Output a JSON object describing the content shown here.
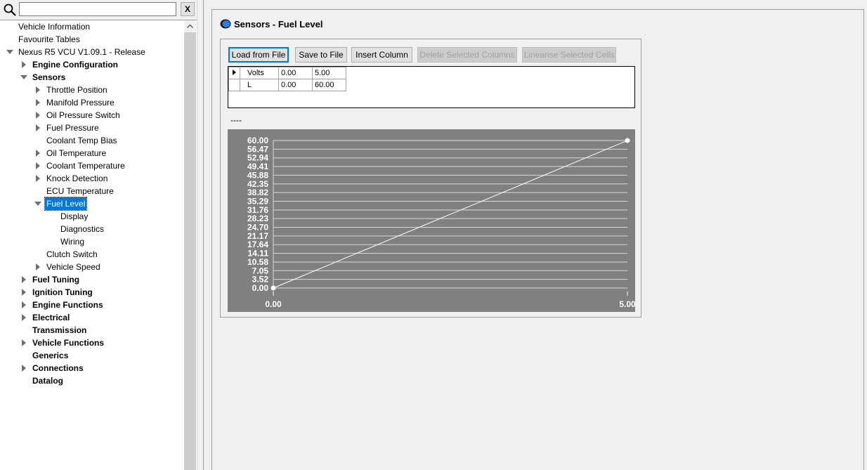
{
  "search": {
    "value": "",
    "clear_label": "X"
  },
  "tree": [
    {
      "id": "vehicle-information",
      "label": "Vehicle Information",
      "depth": 0,
      "arrow": "none",
      "bold": false
    },
    {
      "id": "favourite-tables",
      "label": "Favourite Tables",
      "depth": 0,
      "arrow": "none",
      "bold": false
    },
    {
      "id": "nexus-r5-vcu",
      "label": "Nexus R5 VCU V1.09.1 - Release",
      "depth": 0,
      "arrow": "expanded",
      "bold": false
    },
    {
      "id": "engine-configuration",
      "label": "Engine Configuration",
      "depth": 1,
      "arrow": "collapsed",
      "bold": true
    },
    {
      "id": "sensors",
      "label": "Sensors",
      "depth": 1,
      "arrow": "expanded",
      "bold": true
    },
    {
      "id": "throttle-position",
      "label": "Throttle Position",
      "depth": 2,
      "arrow": "collapsed",
      "bold": false
    },
    {
      "id": "manifold-pressure",
      "label": "Manifold Pressure",
      "depth": 2,
      "arrow": "collapsed",
      "bold": false
    },
    {
      "id": "oil-pressure-switch",
      "label": "Oil Pressure Switch",
      "depth": 2,
      "arrow": "collapsed",
      "bold": false
    },
    {
      "id": "fuel-pressure",
      "label": "Fuel Pressure",
      "depth": 2,
      "arrow": "collapsed",
      "bold": false
    },
    {
      "id": "coolant-temp-bias",
      "label": "Coolant Temp Bias",
      "depth": 2,
      "arrow": "none",
      "bold": false
    },
    {
      "id": "oil-temperature",
      "label": "Oil Temperature",
      "depth": 2,
      "arrow": "collapsed",
      "bold": false
    },
    {
      "id": "coolant-temperature",
      "label": "Coolant Temperature",
      "depth": 2,
      "arrow": "collapsed",
      "bold": false
    },
    {
      "id": "knock-detection",
      "label": "Knock Detection",
      "depth": 2,
      "arrow": "collapsed",
      "bold": false
    },
    {
      "id": "ecu-temperature",
      "label": "ECU Temperature",
      "depth": 2,
      "arrow": "none",
      "bold": false
    },
    {
      "id": "fuel-level",
      "label": "Fuel Level",
      "depth": 2,
      "arrow": "expanded",
      "bold": false,
      "selected": true
    },
    {
      "id": "display",
      "label": "Display",
      "depth": 3,
      "arrow": "none",
      "bold": false
    },
    {
      "id": "diagnostics",
      "label": "Diagnostics",
      "depth": 3,
      "arrow": "none",
      "bold": false
    },
    {
      "id": "wiring",
      "label": "Wiring",
      "depth": 3,
      "arrow": "none",
      "bold": false
    },
    {
      "id": "clutch-switch",
      "label": "Clutch Switch",
      "depth": 2,
      "arrow": "none",
      "bold": false
    },
    {
      "id": "vehicle-speed",
      "label": "Vehicle Speed",
      "depth": 2,
      "arrow": "collapsed",
      "bold": false
    },
    {
      "id": "fuel-tuning",
      "label": "Fuel Tuning",
      "depth": 1,
      "arrow": "collapsed",
      "bold": true
    },
    {
      "id": "ignition-tuning",
      "label": "Ignition Tuning",
      "depth": 1,
      "arrow": "collapsed",
      "bold": true
    },
    {
      "id": "engine-functions",
      "label": "Engine Functions",
      "depth": 1,
      "arrow": "collapsed",
      "bold": true
    },
    {
      "id": "electrical",
      "label": "Electrical",
      "depth": 1,
      "arrow": "collapsed",
      "bold": true
    },
    {
      "id": "transmission",
      "label": "Transmission",
      "depth": 1,
      "arrow": "none",
      "bold": true
    },
    {
      "id": "vehicle-functions",
      "label": "Vehicle Functions",
      "depth": 1,
      "arrow": "collapsed",
      "bold": true
    },
    {
      "id": "generics",
      "label": "Generics",
      "depth": 1,
      "arrow": "none",
      "bold": true
    },
    {
      "id": "connections",
      "label": "Connections",
      "depth": 1,
      "arrow": "collapsed",
      "bold": true
    },
    {
      "id": "datalog",
      "label": "Datalog",
      "depth": 1,
      "arrow": "none",
      "bold": true
    }
  ],
  "main": {
    "title": "Sensors - Fuel Level",
    "toolbar": {
      "load": "Load from File",
      "save": "Save to File",
      "insert": "Insert Column",
      "delete": "Delete Selected Columns",
      "linearise": "Linearise Selected Cells"
    },
    "table": [
      {
        "name": "Volts",
        "values": [
          "0.00",
          "5.00"
        ]
      },
      {
        "name": "L",
        "values": [
          "0.00",
          "60.00"
        ]
      }
    ],
    "caption": "----"
  },
  "colors": {
    "chart_bg": "#808080",
    "chart_line": "#ffffff",
    "selection": "#0078d7",
    "primary_border": "#0078d7"
  },
  "chart_data": {
    "type": "line",
    "x": [
      0.0,
      5.0
    ],
    "y": [
      0.0,
      60.0
    ],
    "xticks": [
      "0.00",
      "5.00"
    ],
    "yticks": [
      "0.00",
      "3.52",
      "7.05",
      "10.58",
      "14.11",
      "17.64",
      "21.17",
      "24.70",
      "28.23",
      "31.76",
      "35.29",
      "38.82",
      "42.35",
      "45.88",
      "49.41",
      "52.94",
      "56.47",
      "60.00"
    ],
    "xlim": [
      0,
      5
    ],
    "ylim": [
      0,
      60
    ],
    "grid": true
  }
}
